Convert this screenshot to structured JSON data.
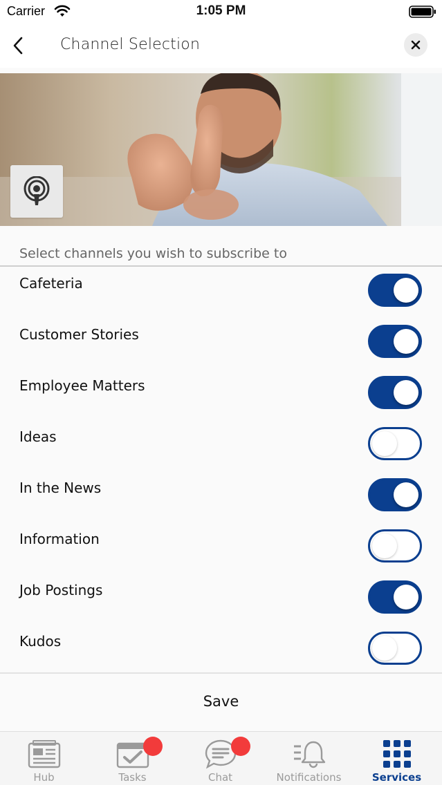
{
  "status_bar": {
    "carrier": "Carrier",
    "time": "1:05 PM"
  },
  "header": {
    "title": "Channel Selection",
    "back_icon": "chevron-left-icon",
    "close_icon": "close-icon"
  },
  "hero": {
    "logo_icon": "broadcast-icon"
  },
  "intro_text": "Select channels you wish to subscribe to",
  "channels": [
    {
      "label": "Cafeteria",
      "enabled": true
    },
    {
      "label": "Customer Stories",
      "enabled": true
    },
    {
      "label": "Employee Matters",
      "enabled": true
    },
    {
      "label": "Ideas",
      "enabled": false
    },
    {
      "label": "In the News",
      "enabled": true
    },
    {
      "label": "Information",
      "enabled": false
    },
    {
      "label": "Job Postings",
      "enabled": true
    },
    {
      "label": "Kudos",
      "enabled": false
    }
  ],
  "save_label": "Save",
  "tabs": [
    {
      "label": "Hub",
      "icon": "newspaper-icon",
      "active": false,
      "badge": false
    },
    {
      "label": "Tasks",
      "icon": "tasks-icon",
      "active": false,
      "badge": true
    },
    {
      "label": "Chat",
      "icon": "chat-icon",
      "active": false,
      "badge": true
    },
    {
      "label": "Notifications",
      "icon": "bell-icon",
      "active": false,
      "badge": false
    },
    {
      "label": "Services",
      "icon": "grid-icon",
      "active": true,
      "badge": false
    }
  ],
  "colors": {
    "accent": "#0b3f8f",
    "badge": "#f23b3b",
    "inactive_tab": "#9a9a9a"
  }
}
